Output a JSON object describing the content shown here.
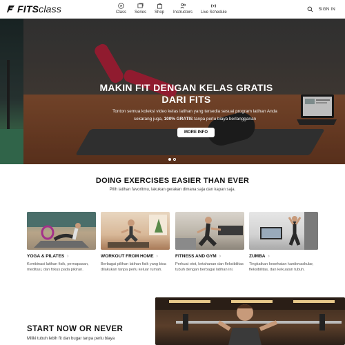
{
  "brand": {
    "bold": "FITS",
    "light": "class"
  },
  "nav": [
    {
      "label": "Class",
      "icon": "play-circle-icon"
    },
    {
      "label": "Series",
      "icon": "series-icon"
    },
    {
      "label": "Shop",
      "icon": "shopping-bag-icon"
    },
    {
      "label": "Instructors",
      "icon": "instructors-icon"
    },
    {
      "label": "Live Schedule",
      "icon": "live-icon"
    }
  ],
  "header": {
    "signin": "SIGN IN",
    "search_icon": "search-icon"
  },
  "hero": {
    "title": "MAKIN FIT DENGAN KELAS GRATIS DARI FITS",
    "sub_1": "Tonton semua koleksi video kelas latihan yang tersedia sesuai program latihan Anda sekarang juga, ",
    "sub_bold": "100% GRATIS",
    "sub_2": " tanpa perlu biaya berlangganan",
    "button": "MORE INFO",
    "slides": 2,
    "active_slide": 1
  },
  "section": {
    "title": "DOING EXERCISES EASIER THAN EVER",
    "subtitle": "Pilih latihan favoritmu, lakukan gerakan dimana saja dan kapan saja."
  },
  "categories": [
    {
      "title": "YOGA & PILATES",
      "desc": "Kombinasi latihan fisik, pernapasan, meditasi, dan fokus pada pikiran."
    },
    {
      "title": "WORKOUT FROM HOME",
      "desc": "Berbagai pilihan latihan fisik yang bisa dilakukan tanpa perlu keluar rumah."
    },
    {
      "title": "FITNESS AND GYM",
      "desc": "Perkuat otot, ketahanan dan fleksibilitas tubuh dengan berbagai latihan ini."
    },
    {
      "title": "ZUMBA",
      "desc": "Tingkatkan kesehatan kardiovaskular, fleksibilitas, dan kekuatan tubuh."
    }
  ],
  "bottom": {
    "title": "START NOW OR NEVER",
    "subtitle": "Miliki tubuh lebih fit dan bugar tanpa perlu biaya"
  },
  "colors": {
    "accent_red": "#b0213a",
    "text": "#111111"
  }
}
